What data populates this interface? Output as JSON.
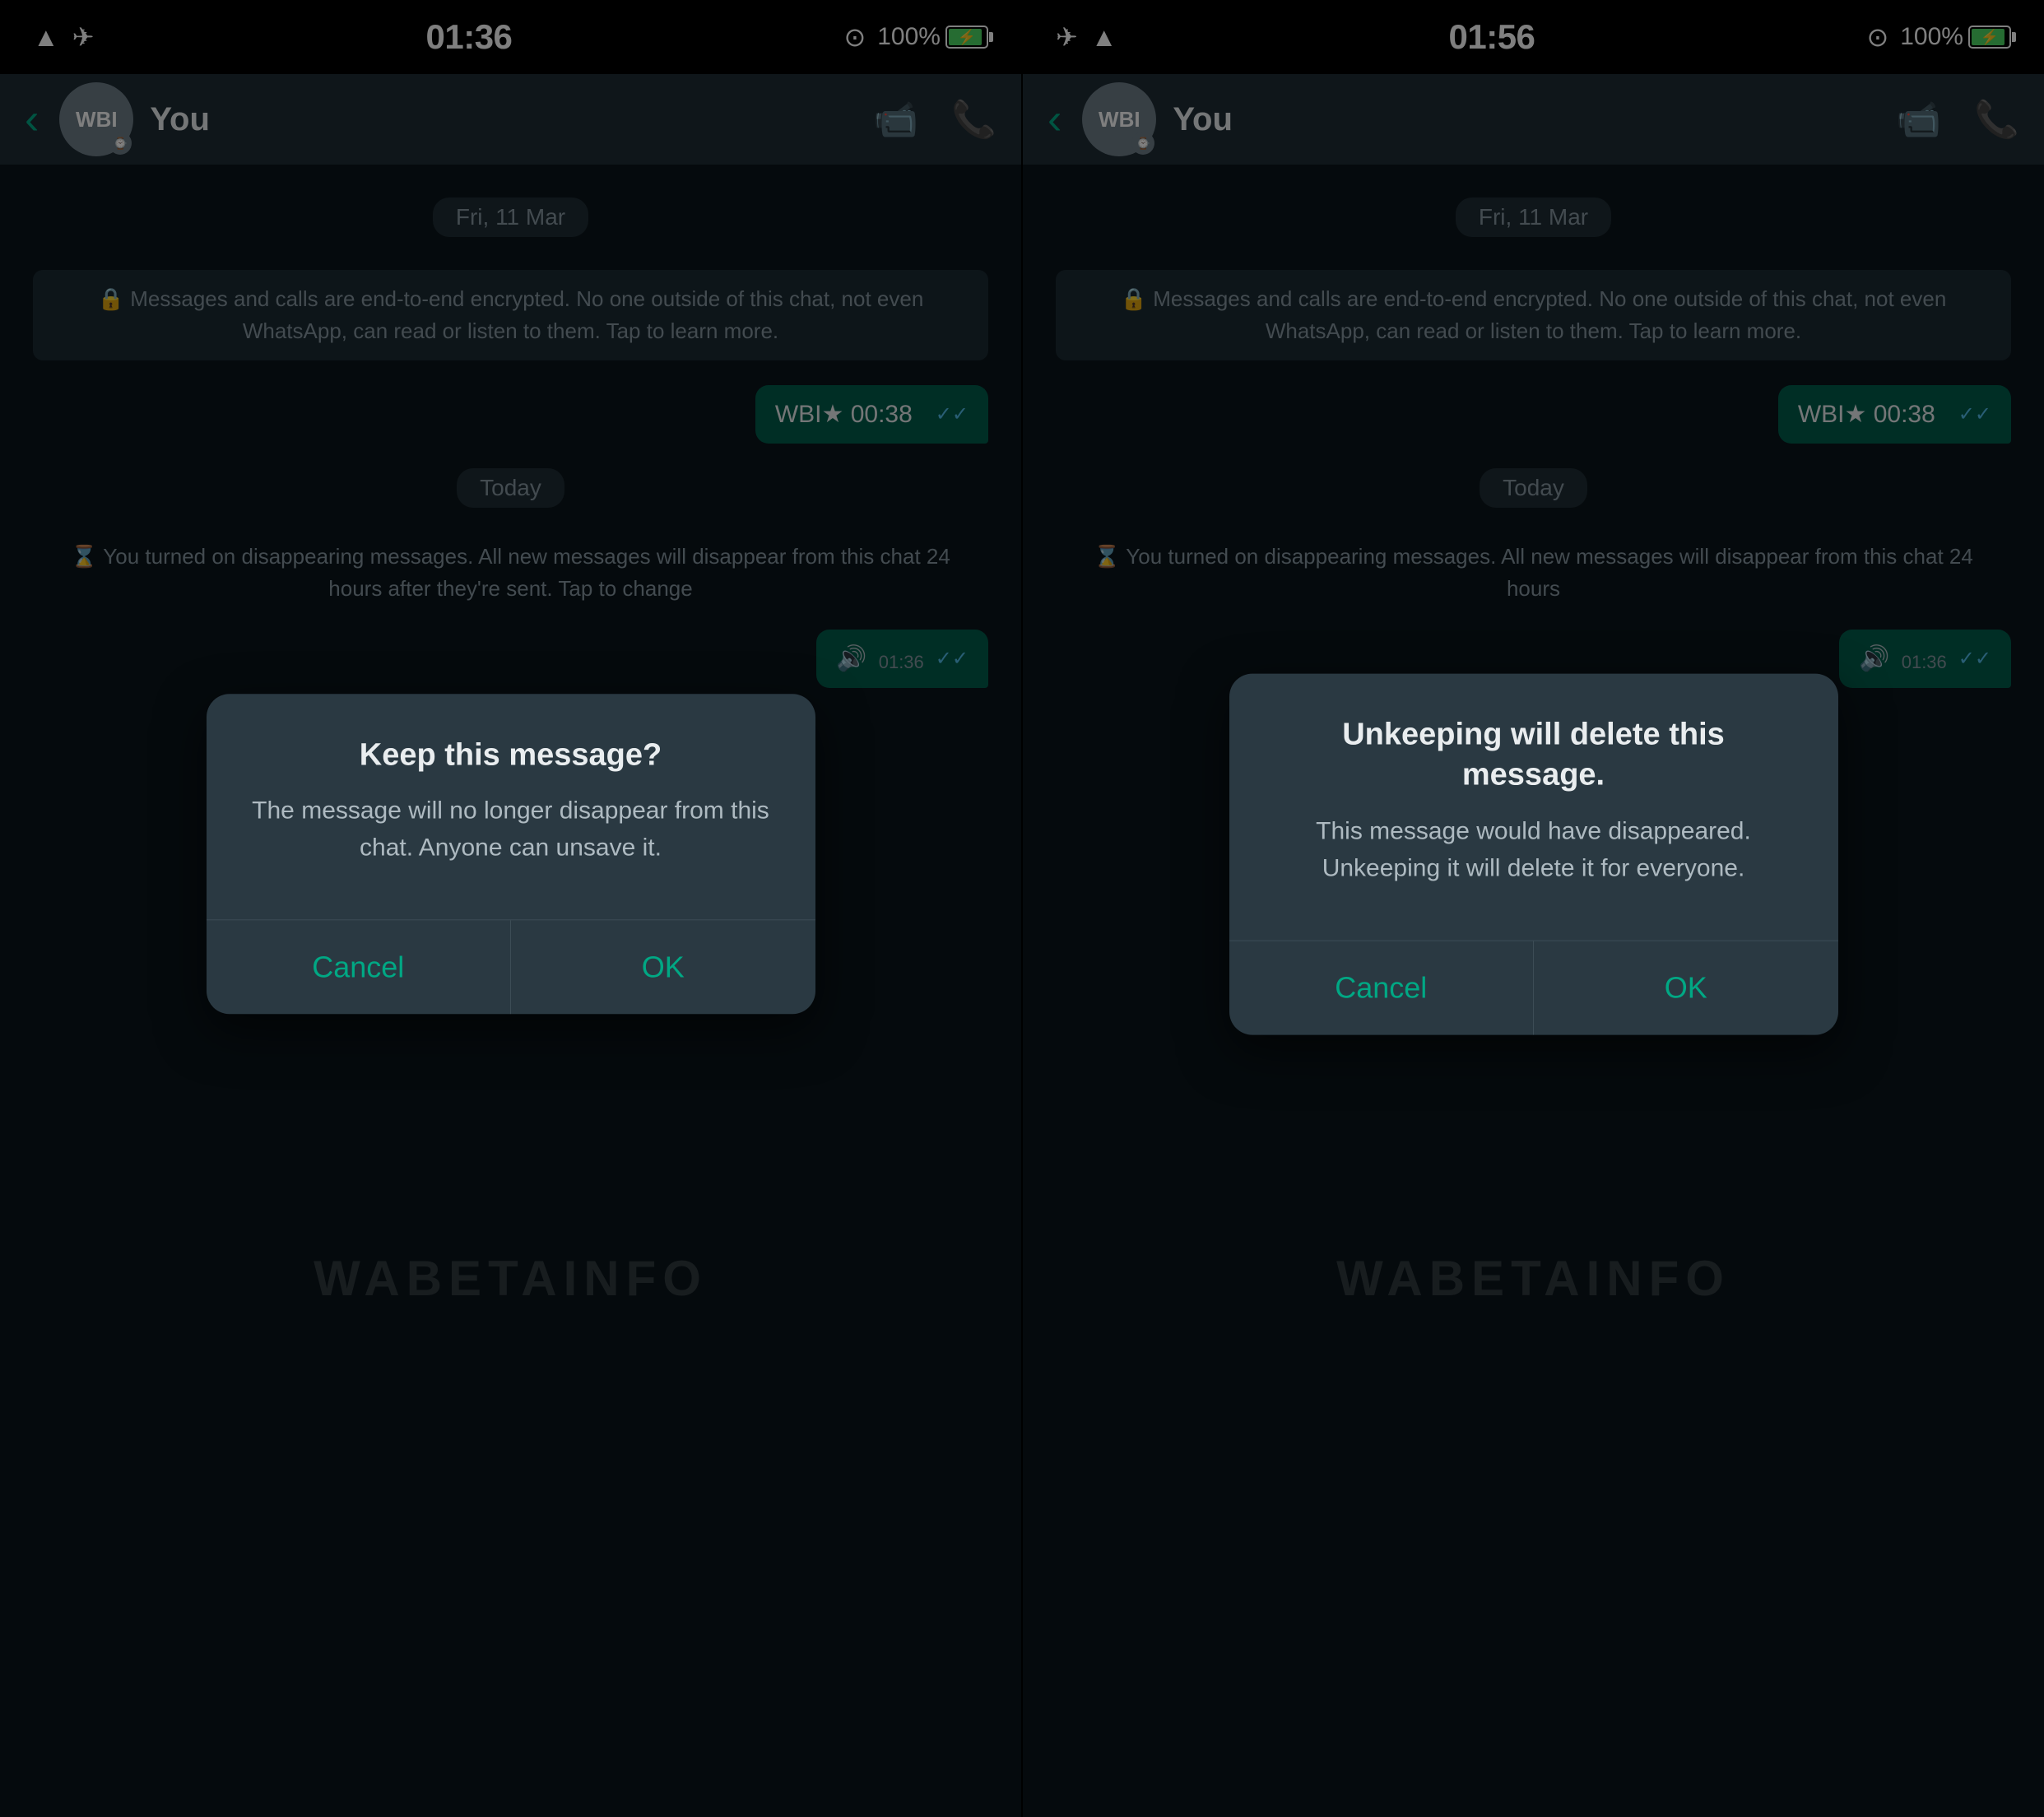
{
  "screen1": {
    "statusBar": {
      "time": "01:36",
      "battery": "100%",
      "icons": [
        "wifi",
        "airplane"
      ]
    },
    "header": {
      "contactName": "You",
      "avatarInitials": "WBI"
    },
    "chat": {
      "dateSeparator1": "Fri, 11 Mar",
      "encryptionNotice": "🔒 Messages and calls are end-to-end encrypted. No one outside of this chat, not even WhatsApp, can read or listen to them. Tap to learn more.",
      "voiceMessage": "WBI★ 00:38",
      "dateSeparator2": "Today",
      "systemMessage": "⌛ You turned on disappearing messages. All new messages will disappear from this chat 24 hours after they're sent. Tap to change",
      "messageBubbleTime": "01:36"
    },
    "dialog": {
      "title": "Keep this message?",
      "message": "The message will no longer disappear from this chat. Anyone can unsave it.",
      "cancelLabel": "Cancel",
      "okLabel": "OK"
    }
  },
  "screen2": {
    "statusBar": {
      "time": "01:56",
      "battery": "100%",
      "icons": [
        "wifi",
        "airplane"
      ]
    },
    "header": {
      "contactName": "You",
      "avatarInitials": "WBI"
    },
    "chat": {
      "dateSeparator1": "Fri, 11 Mar",
      "encryptionNotice": "🔒 Messages and calls are end-to-end encrypted. No one outside of this chat, not even WhatsApp, can read or listen to them. Tap to learn more.",
      "voiceMessage": "WBI★ 00:38",
      "dateSeparator2": "Today",
      "systemMessage": "⌛ You turned on disappearing messages. All new messages will disappear from this chat 24 hours",
      "messageBubbleTime": "01:36"
    },
    "dialog": {
      "title": "Unkeeping will delete this message.",
      "message": "This message would have disappeared. Unkeeping it will delete it for everyone.",
      "cancelLabel": "Cancel",
      "okLabel": "OK"
    }
  },
  "watermark": "WABETAINFO"
}
